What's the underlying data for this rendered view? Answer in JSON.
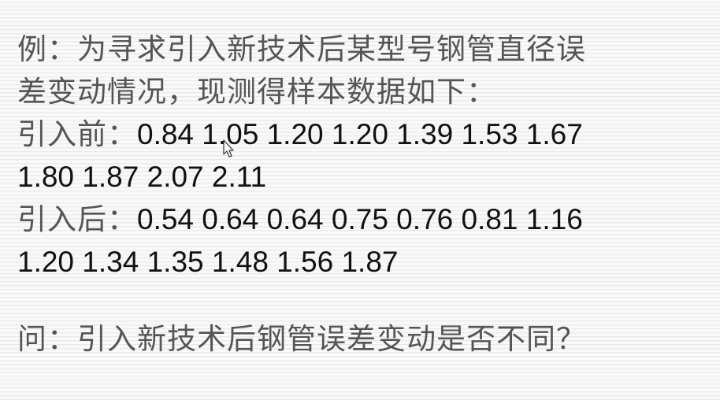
{
  "example": {
    "line1": "例：为寻求引入新技术后某型号钢管直径误",
    "line2": "差变动情况，现测得样本数据如下："
  },
  "before": {
    "label": "引入前：",
    "values_line1": "0.84 1.05 1.20 1.20 1.39 1.53 1.67",
    "values_line2": "1.80 1.87 2.07 2.11"
  },
  "after": {
    "label": "引入后：",
    "values_line1": "0.54 0.64 0.64 0.75 0.76 0.81 1.16",
    "values_line2": "1.20 1.34 1.35 1.48 1.56 1.87"
  },
  "question": "问：引入新技术后钢管误差变动是否不同？",
  "icons": {
    "cursor": "mouse-pointer-icon"
  }
}
